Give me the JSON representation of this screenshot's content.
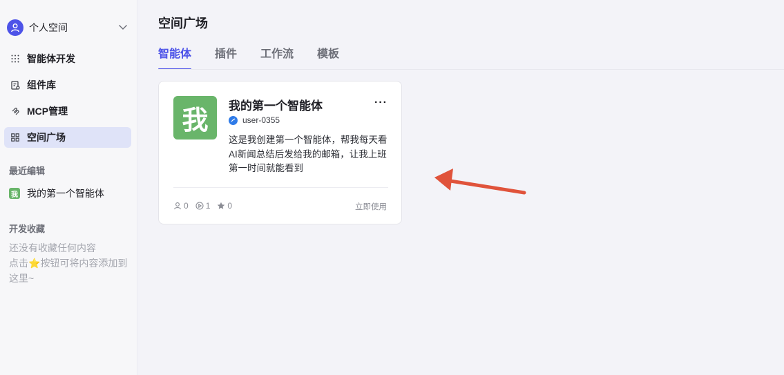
{
  "sidebar": {
    "workspace_name": "个人空间",
    "nav": [
      {
        "label": "智能体开发",
        "icon": "grid-dots-icon"
      },
      {
        "label": "组件库",
        "icon": "library-icon"
      },
      {
        "label": "MCP管理",
        "icon": "mcp-icon"
      },
      {
        "label": "空间广场",
        "icon": "squares-icon",
        "active": true
      }
    ],
    "recent_title": "最近编辑",
    "recent_items": [
      {
        "label": "我的第一个智能体",
        "badge": "我"
      }
    ],
    "favorites_title": "开发收藏",
    "favorites_empty": "还没有收藏任何内容",
    "favorites_hint_prefix": "点击",
    "favorites_hint_icon": "⭐",
    "favorites_hint_suffix": "按钮可将内容添加到这里~"
  },
  "main": {
    "title": "空间广场",
    "tabs": [
      {
        "label": "智能体",
        "active": true
      },
      {
        "label": "插件"
      },
      {
        "label": "工作流"
      },
      {
        "label": "模板"
      }
    ],
    "card": {
      "avatar_text": "我",
      "title": "我的第一个智能体",
      "more": "···",
      "author": "user-0355",
      "description": "这是我创建第一个智能体，帮我每天看AI新闻总结后发给我的邮箱，让我上班第一时间就能看到",
      "stats": {
        "users": "0",
        "runs": "1",
        "stars": "0"
      },
      "action": "立即使用"
    }
  },
  "colors": {
    "accent": "#4d53e8",
    "badge_green": "#69b56a",
    "annotation_arrow": "#e0533b"
  }
}
